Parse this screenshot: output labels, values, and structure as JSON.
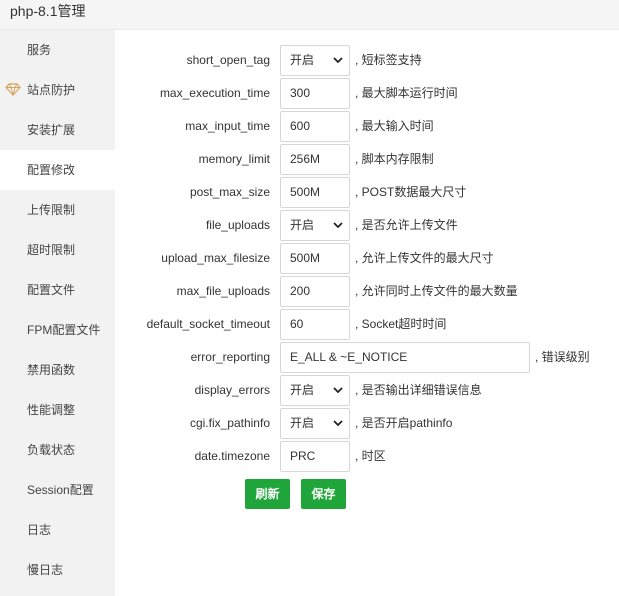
{
  "title": "php-8.1管理",
  "sidebar": {
    "items": [
      {
        "label": "服务"
      },
      {
        "label": "站点防护"
      },
      {
        "label": "安装扩展"
      },
      {
        "label": "配置修改",
        "active": true
      },
      {
        "label": "上传限制"
      },
      {
        "label": "超时限制"
      },
      {
        "label": "配置文件"
      },
      {
        "label": "FPM配置文件"
      },
      {
        "label": "禁用函数"
      },
      {
        "label": "性能调整"
      },
      {
        "label": "负载状态"
      },
      {
        "label": "Session配置"
      },
      {
        "label": "日志"
      },
      {
        "label": "慢日志"
      }
    ]
  },
  "settings": [
    {
      "label": "short_open_tag",
      "value": "开启",
      "type": "select",
      "desc": ", 短标签支持"
    },
    {
      "label": "max_execution_time",
      "value": "300",
      "type": "input",
      "desc": ", 最大脚本运行时间"
    },
    {
      "label": "max_input_time",
      "value": "600",
      "type": "input",
      "desc": ", 最大输入时间"
    },
    {
      "label": "memory_limit",
      "value": "256M",
      "type": "input",
      "desc": ", 脚本内存限制"
    },
    {
      "label": "post_max_size",
      "value": "500M",
      "type": "input",
      "desc": ", POST数据最大尺寸"
    },
    {
      "label": "file_uploads",
      "value": "开启",
      "type": "select",
      "desc": ", 是否允许上传文件"
    },
    {
      "label": "upload_max_filesize",
      "value": "500M",
      "type": "input",
      "desc": ", 允许上传文件的最大尺寸"
    },
    {
      "label": "max_file_uploads",
      "value": "200",
      "type": "input",
      "desc": ", 允许同时上传文件的最大数量"
    },
    {
      "label": "default_socket_timeout",
      "value": "60",
      "type": "input",
      "desc": ", Socket超时时间"
    },
    {
      "label": "error_reporting",
      "value": "E_ALL & ~E_NOTICE",
      "type": "input-wide",
      "desc": ", 错误级别"
    },
    {
      "label": "display_errors",
      "value": "开启",
      "type": "select",
      "desc": ", 是否输出详细错误信息"
    },
    {
      "label": "cgi.fix_pathinfo",
      "value": "开启",
      "type": "select",
      "desc": ", 是否开启pathinfo"
    },
    {
      "label": "date.timezone",
      "value": "PRC",
      "type": "input",
      "desc": ", 时区"
    }
  ],
  "buttons": {
    "refresh": "刷新",
    "save": "保存"
  },
  "colors": {
    "accent": "#20a53a",
    "sidebar_bg": "#f2f2f2",
    "gem_icon": "#d9a25a"
  },
  "icons": {
    "protection": "gem-icon",
    "select_arrow": "chevron-down-icon"
  }
}
